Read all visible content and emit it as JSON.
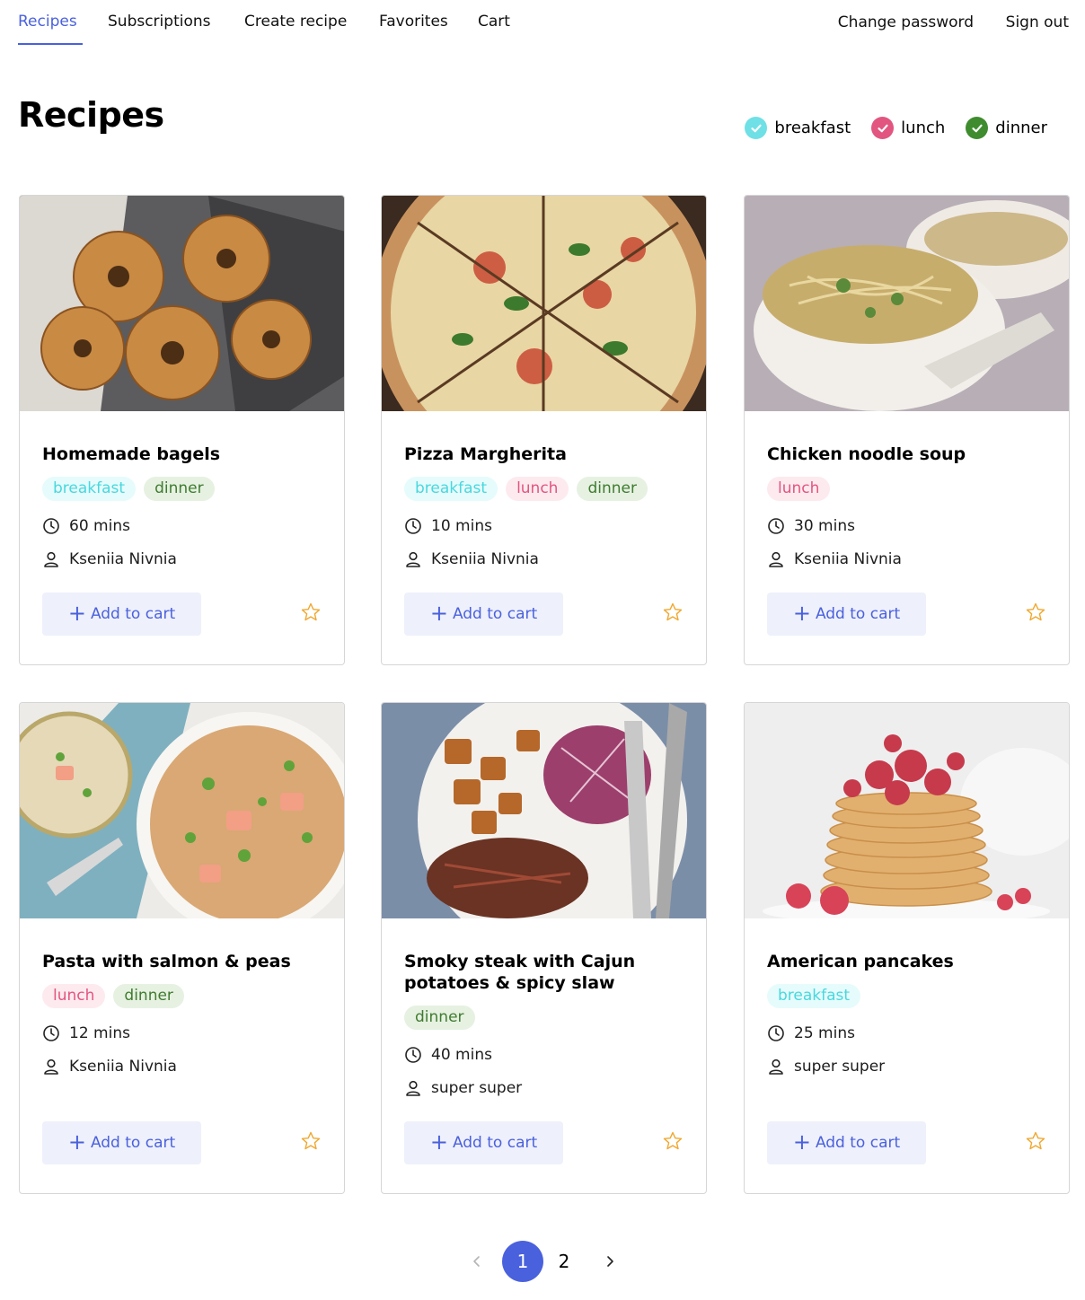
{
  "nav": {
    "left": [
      "Recipes",
      "Subscriptions",
      "Create recipe",
      "Favorites",
      "Cart"
    ],
    "change_password": "Change password",
    "sign_out": "Sign out"
  },
  "page": {
    "title": "Recipes"
  },
  "filters": [
    {
      "label": "breakfast",
      "color": "#48d8de",
      "checked": true
    },
    {
      "label": "lunch",
      "color": "#e25580",
      "checked": true
    },
    {
      "label": "dinner",
      "color": "#3f7c2f",
      "checked": true
    }
  ],
  "recipes": [
    {
      "title": "Homemade bagels",
      "tags": [
        "breakfast",
        "dinner"
      ],
      "time": "60 mins",
      "author": "Kseniia Nivnia",
      "add_label": "Add to cart",
      "image": "bagels"
    },
    {
      "title": "Pizza Margherita",
      "tags": [
        "breakfast",
        "lunch",
        "dinner"
      ],
      "time": "10 mins",
      "author": "Kseniia Nivnia",
      "add_label": "Add to cart",
      "image": "pizza"
    },
    {
      "title": "Chicken noodle soup",
      "tags": [
        "lunch"
      ],
      "time": "30 mins",
      "author": "Kseniia Nivnia",
      "add_label": "Add to cart",
      "image": "soup"
    },
    {
      "title": "Pasta with salmon & peas",
      "tags": [
        "lunch",
        "dinner"
      ],
      "time": "12 mins",
      "author": "Kseniia Nivnia",
      "add_label": "Add to cart",
      "image": "pasta"
    },
    {
      "title": "Smoky steak with Cajun potatoes & spicy slaw",
      "tags": [
        "dinner"
      ],
      "time": "40 mins",
      "author": "super super",
      "add_label": "Add to cart",
      "image": "steak"
    },
    {
      "title": "American pancakes",
      "tags": [
        "breakfast"
      ],
      "time": "25 mins",
      "author": "super super",
      "add_label": "Add to cart",
      "image": "pancakes"
    }
  ],
  "pagination": {
    "pages": [
      "1",
      "2"
    ],
    "current": "1"
  }
}
